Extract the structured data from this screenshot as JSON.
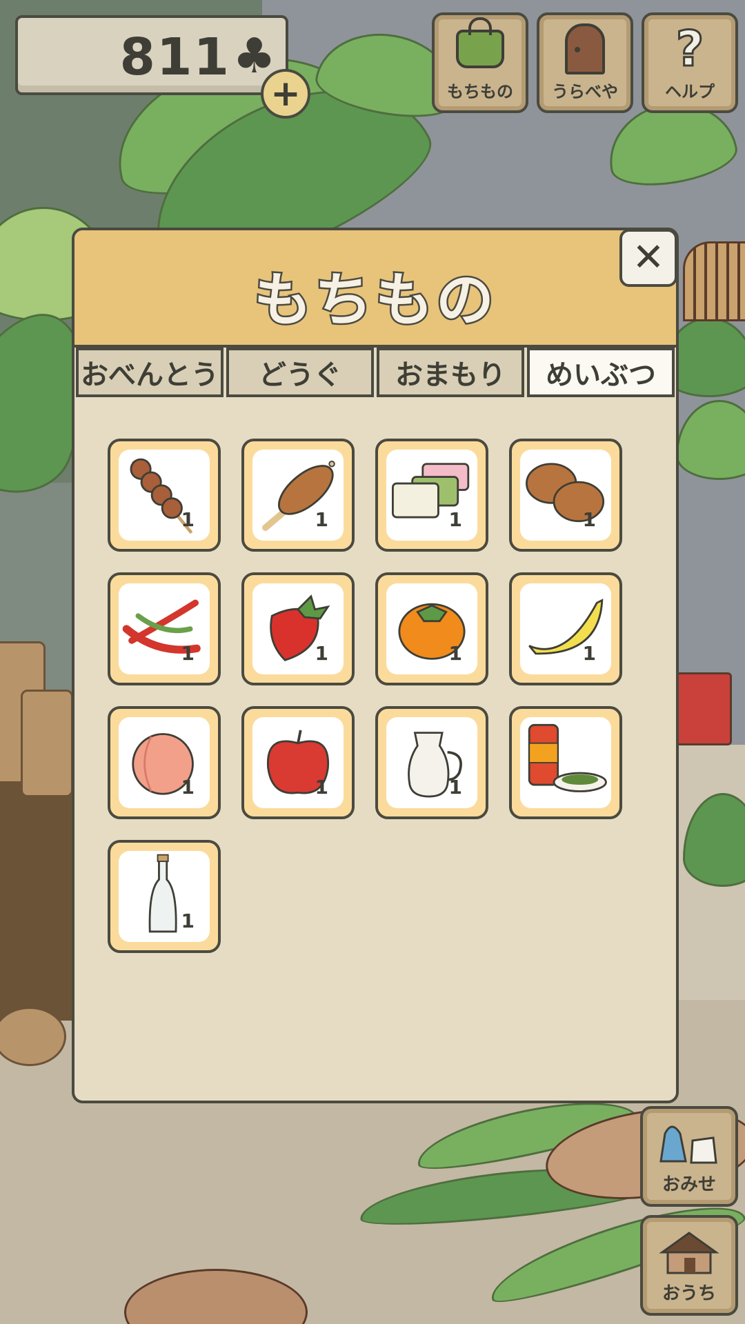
{
  "header": {
    "clover_count": "811",
    "clover_symbol": "♣",
    "plus_symbol": "+"
  },
  "top_buttons": [
    {
      "label": "もちもの",
      "icon": "bag-icon"
    },
    {
      "label": "うらべや",
      "icon": "door-icon"
    },
    {
      "label": "ヘルプ",
      "icon": "help-icon"
    }
  ],
  "dialog": {
    "title": "もちもの",
    "close_symbol": "✕",
    "tabs": [
      {
        "label": "おべんとう",
        "active": false
      },
      {
        "label": "どうぐ",
        "active": false
      },
      {
        "label": "おまもり",
        "active": false
      },
      {
        "label": "めいぶつ",
        "active": true
      }
    ],
    "items": [
      {
        "icon": "dango-icon",
        "qty": "1"
      },
      {
        "icon": "mitarashi-skewer-icon",
        "qty": "1"
      },
      {
        "icon": "tricolor-mochi-icon",
        "qty": "1"
      },
      {
        "icon": "manju-buns-icon",
        "qty": "1"
      },
      {
        "icon": "chili-peppers-icon",
        "qty": "1"
      },
      {
        "icon": "strawberry-icon",
        "qty": "1"
      },
      {
        "icon": "persimmon-icon",
        "qty": "1"
      },
      {
        "icon": "banana-icon",
        "qty": "1"
      },
      {
        "icon": "peach-icon",
        "qty": "1"
      },
      {
        "icon": "apple-icon",
        "qty": "1"
      },
      {
        "icon": "milk-pitcher-icon",
        "qty": "1"
      },
      {
        "icon": "tea-can-icon",
        "qty": ""
      },
      {
        "icon": "glass-bottle-icon",
        "qty": "1"
      }
    ]
  },
  "side_buttons": [
    {
      "label": "おみせ",
      "icon": "shop-icon"
    },
    {
      "label": "おうち",
      "icon": "house-icon"
    }
  ],
  "colors": {
    "panel": "#e6dcc3",
    "header": "#e8c37a",
    "slot_border": "#fbdb9c",
    "outline": "#4a4a40"
  }
}
